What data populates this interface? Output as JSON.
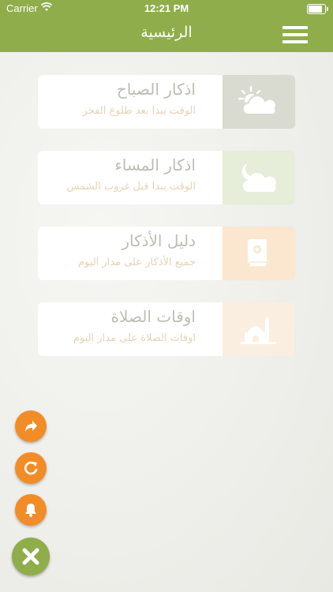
{
  "status_bar": {
    "carrier": "Carrier",
    "time": "12:21 PM",
    "battery_level": 0.9
  },
  "navbar": {
    "title": "الرئيسية",
    "menu_icon": "hamburger-menu-icon"
  },
  "cards": [
    {
      "title": "اذكار الصباح",
      "subtitle": "الوقت يبدا بعد طلوع الفجر",
      "icon": "sun-cloud-icon",
      "icon_bg": "#d9dad0"
    },
    {
      "title": "اذكار المساء",
      "subtitle": "الوقت يبدا قبل غروب الشمس",
      "icon": "moon-cloud-icon",
      "icon_bg": "#e6edd8"
    },
    {
      "title": "دليل الأذكار",
      "subtitle": "جميع الأذكار على مدار اليوم",
      "icon": "book-icon",
      "icon_bg": "#fbe6d0"
    },
    {
      "title": "اوقات الصلاة",
      "subtitle": "اوقات الصلاة على مدار اليوم",
      "icon": "mosque-icon",
      "icon_bg": "#faeee0"
    }
  ],
  "fabs": [
    {
      "icon": "share-icon",
      "color": "#f28c26"
    },
    {
      "icon": "refresh-icon",
      "color": "#f28c26"
    },
    {
      "icon": "bell-icon",
      "color": "#f28c26"
    },
    {
      "icon": "close-icon",
      "color": "#8fad4a"
    }
  ],
  "colors": {
    "brand_green": "#8fad4a",
    "accent_orange": "#f28c26"
  }
}
